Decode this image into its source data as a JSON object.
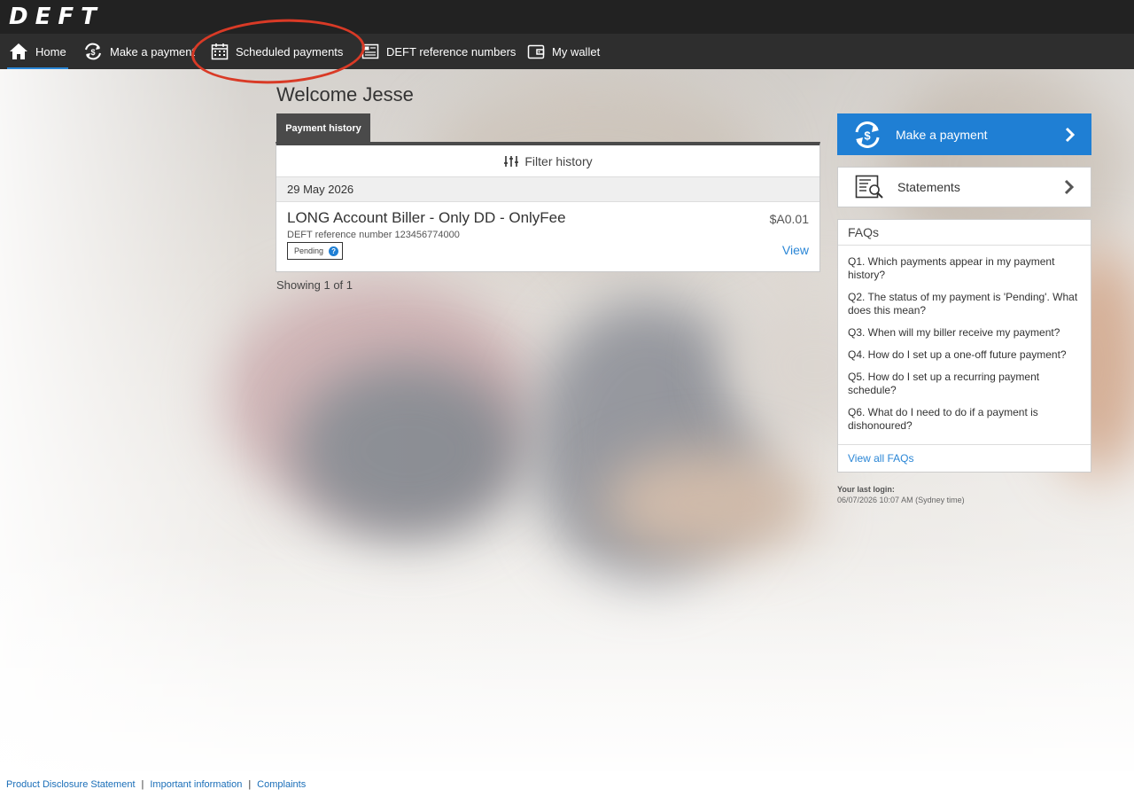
{
  "brand": {
    "logo": "DEFT"
  },
  "nav": {
    "items": [
      {
        "label": "Home",
        "icon": "home-icon"
      },
      {
        "label": "Make a payment",
        "icon": "payment-cycle-icon"
      },
      {
        "label": "Scheduled payments",
        "icon": "calendar-icon"
      },
      {
        "label": "DEFT reference numbers",
        "icon": "reference-card-icon"
      },
      {
        "label": "My wallet",
        "icon": "wallet-icon"
      }
    ],
    "active": "Home"
  },
  "main": {
    "welcome": "Welcome Jesse",
    "tab_label": "Payment history",
    "filter_label": "Filter history",
    "date": "29 May 2026",
    "payment": {
      "biller": "LONG Account Biller - Only DD - OnlyFee",
      "reference": "DEFT reference number 123456774000",
      "status": "Pending",
      "amount": "$A0.01",
      "view_label": "View"
    },
    "showing": "Showing 1 of 1"
  },
  "sidebar": {
    "make_payment_label": "Make a payment",
    "statements_label": "Statements",
    "faq_title": "FAQs",
    "faqs": [
      "Q1. Which payments appear in my payment history?",
      "Q2. The status of my payment is 'Pending'. What does this mean?",
      "Q3. When will my biller receive my payment?",
      "Q4. How do I set up a one-off future payment?",
      "Q5. How do I set up a recurring payment schedule?",
      "Q6. What do I need to do if a payment is dishonoured?"
    ],
    "view_all_label": "View all FAQs",
    "last_login_label": "Your last login:",
    "last_login_value": "06/07/2026 10:07 AM (Sydney time)"
  },
  "footer": {
    "links": [
      "Product Disclosure Statement",
      "Important information",
      "Complaints"
    ],
    "separator": "|"
  },
  "colors": {
    "accent": "#1f7fd4",
    "header": "#222222",
    "nav": "#2e2e2e",
    "annotation": "#d93a26"
  }
}
